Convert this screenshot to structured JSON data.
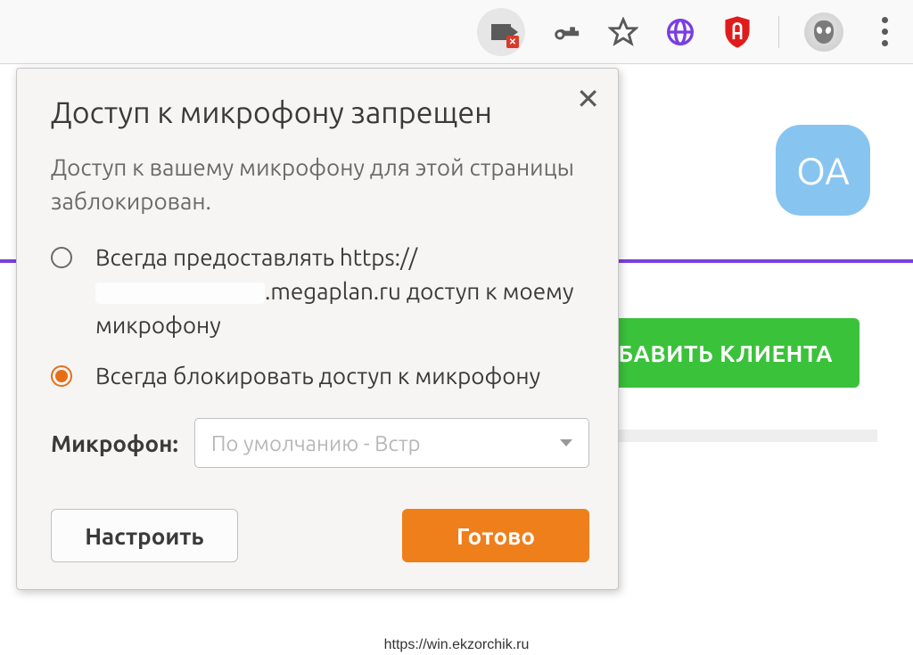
{
  "toolbar": {
    "icons": {
      "camera_blocked": "camera-blocked-icon",
      "key": "key-icon",
      "star": "star-icon",
      "globe": "globe-icon",
      "adblock": "adblock-icon",
      "profile": "profile-icon",
      "menu": "menu-icon"
    }
  },
  "page": {
    "avatar_initials": "OA",
    "button_text": "БАВИТЬ КЛИЕНТА",
    "colors": {
      "accent_purple": "#7a3ee0",
      "button_green": "#3bc23b",
      "avatar_blue": "#87c5f0"
    }
  },
  "popup": {
    "title": "Доступ к микрофону запрещен",
    "subtitle": "Доступ к вашему микрофону для этой страницы заблокирован.",
    "option_allow_prefix": "Всегда предоставлять https://",
    "option_allow_domain": ".megaplan.ru доступ к моему микрофону",
    "option_block": "Всегда блокировать доступ к микрофону",
    "selected_index": 1,
    "select_label": "Микрофон:",
    "select_value": "По умолчанию - Встр",
    "manage_button": "Настроить",
    "done_button": "Готово",
    "colors": {
      "primary_orange": "#ef7f1a",
      "radio_selected": "#e86e16"
    }
  },
  "footer": {
    "url": "https://win.ekzorchik.ru"
  }
}
